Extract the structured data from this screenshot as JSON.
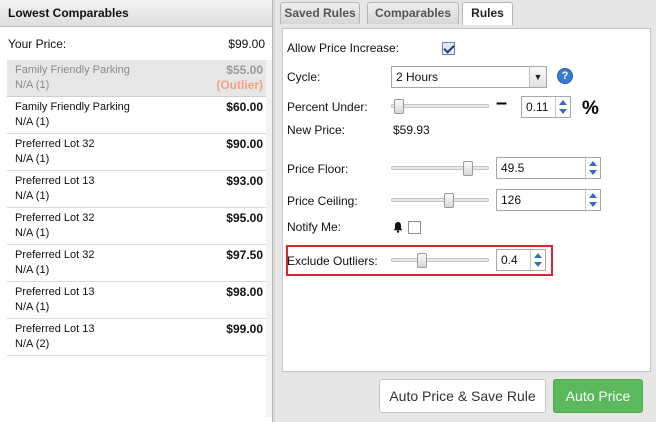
{
  "left_panel": {
    "header": "Lowest Comparables",
    "your_price_label": "Your Price:",
    "your_price_value": "$99.00",
    "comparables": [
      {
        "name": "Family Friendly Parking",
        "sub": "N/A (1)",
        "price": "$55.00",
        "flag": "(Outlier)",
        "outlier": true
      },
      {
        "name": "Family Friendly Parking",
        "sub": "N/A (1)",
        "price": "$60.00"
      },
      {
        "name": "Preferred Lot 32",
        "sub": "N/A (1)",
        "price": "$90.00"
      },
      {
        "name": "Preferred Lot 13",
        "sub": "N/A (1)",
        "price": "$93.00"
      },
      {
        "name": "Preferred Lot 32",
        "sub": "N/A (1)",
        "price": "$95.00"
      },
      {
        "name": "Preferred Lot 32",
        "sub": "N/A (1)",
        "price": "$97.50"
      },
      {
        "name": "Preferred Lot 13",
        "sub": "N/A (1)",
        "price": "$98.00"
      },
      {
        "name": "Preferred Lot 13",
        "sub": "N/A (2)",
        "price": "$99.00"
      }
    ]
  },
  "tabs": [
    {
      "label": "Saved Rules"
    },
    {
      "label": "Comparables"
    },
    {
      "label": "Rules",
      "active": true
    }
  ],
  "rules": {
    "allow_increase_label": "Allow Price Increase:",
    "allow_increase_checked": true,
    "cycle_label": "Cycle:",
    "cycle_value": "2 Hours",
    "percent_under_label": "Percent Under:",
    "percent_under_value": "0.11",
    "percent_under_slider": 0.03,
    "minus_symbol": "–",
    "percent_symbol": "%",
    "new_price_label": "New Price:",
    "new_price_value": "$59.93",
    "price_floor_label": "Price Floor:",
    "price_floor_value": "49.5",
    "price_floor_slider": 0.82,
    "price_ceiling_label": "Price Ceiling:",
    "price_ceiling_value": "126",
    "price_ceiling_slider": 0.6,
    "notify_label": "Notify Me:",
    "notify_checked": false,
    "exclude_outliers_label": "Exclude Outliers:",
    "exclude_outliers_value": "0.4",
    "exclude_outliers_slider": 0.3
  },
  "buttons": {
    "auto_price_save": "Auto Price & Save Rule",
    "auto_price": "Auto Price"
  },
  "colors": {
    "highlight_border": "#d8262e",
    "primary_button": "#5cb85c",
    "outlier_flag": "#f2a27e",
    "help_icon": "#3a7bd5"
  }
}
